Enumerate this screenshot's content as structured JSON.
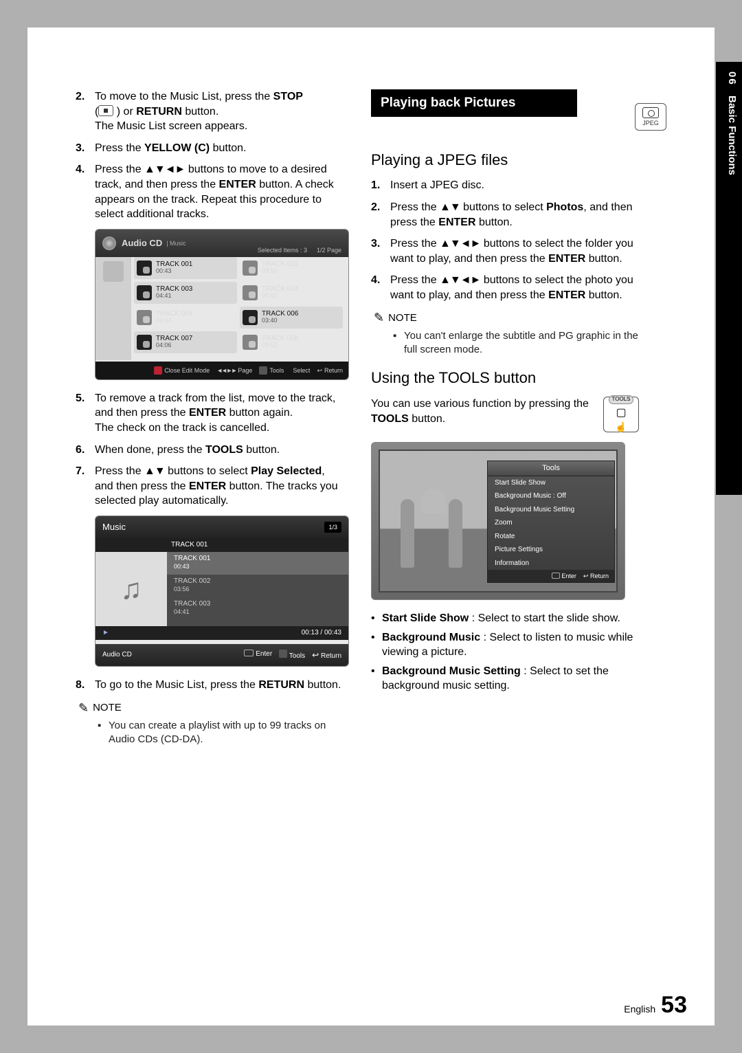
{
  "side": {
    "chapter_num": "06",
    "chapter_label": "Basic Functions"
  },
  "footer": {
    "lang": "English",
    "page": "53"
  },
  "jpeg_badge": "JPEG",
  "left": {
    "s2": {
      "num": "2.",
      "text_a": "To move to the Music List, press the ",
      "stop": "STOP",
      "text_b": " (",
      "text_c": " ) or ",
      "return": "RETURN",
      "text_d": " button.",
      "line2": "The Music List screen appears."
    },
    "s3": {
      "num": "3.",
      "text_a": "Press the ",
      "yellow": "YELLOW (C)",
      "text_b": " button."
    },
    "s4": {
      "num": "4.",
      "text_a": "Press the ",
      "arrows": "▲▼◄►",
      "text_b": " buttons to move to a desired track, and then press the ",
      "enter": "ENTER",
      "text_c": " button. A check appears on the track. Repeat this procedure to select additional tracks."
    },
    "s5": {
      "num": "5.",
      "text_a": "To remove a track from the list, move to the track, and then press the ",
      "enter": "ENTER",
      "text_b": " button again.",
      "line2": "The check on the track is cancelled."
    },
    "s6": {
      "num": "6.",
      "text_a": "When done, press the ",
      "tools": "TOOLS",
      "text_b": " button."
    },
    "s7": {
      "num": "7.",
      "text_a": "Press the ",
      "arrows": "▲▼",
      "text_b": " buttons to select ",
      "play": "Play Selected",
      "text_c": ", and then press the ",
      "enter": "ENTER",
      "text_d": " button. The tracks you selected play automatically."
    },
    "s8": {
      "num": "8.",
      "text_a": "To go to the Music List, press the ",
      "return": "RETURN",
      "text_b": " button."
    },
    "note_label": "NOTE",
    "note1": "You can create a playlist with up to 99 tracks on Audio CDs (CD-DA)."
  },
  "ui1": {
    "title": "Audio CD",
    "subtitle": "| Music",
    "selected": "Selected Items : 3",
    "page": "1/2 Page",
    "tracks": [
      {
        "name": "TRACK 001",
        "time": "00:43",
        "sel": true
      },
      {
        "name": "TRACK 002",
        "time": "03:56",
        "sel": false,
        "dim": true
      },
      {
        "name": "TRACK 003",
        "time": "04:41",
        "sel": true
      },
      {
        "name": "TRACK 004",
        "time": "04:02",
        "sel": false,
        "dim": true
      },
      {
        "name": "TRACK 005",
        "time": "03:43",
        "sel": false,
        "dim": true
      },
      {
        "name": "TRACK 006",
        "time": "03:40",
        "sel": true
      },
      {
        "name": "TRACK 007",
        "time": "04:06",
        "sel": true
      },
      {
        "name": "TRACK 008",
        "time": "03:52",
        "sel": false,
        "dim": true
      }
    ],
    "close": "Close Edit Mode",
    "pagebtn": "Page",
    "tools": "Tools",
    "select": "Select",
    "return": "Return"
  },
  "ui2": {
    "title": "Music",
    "page": "1/3",
    "now": "TRACK 001",
    "rows": [
      {
        "name": "TRACK 001",
        "time": "00:43"
      },
      {
        "name": "TRACK 002",
        "time": "03:56"
      },
      {
        "name": "TRACK 003",
        "time": "04:41"
      }
    ],
    "elapsed": "00:13 / 00:43",
    "source": "Audio CD",
    "enter": "Enter",
    "tools": "Tools",
    "return": "Return"
  },
  "right": {
    "banner": "Playing back Pictures",
    "h1": "Playing a JPEG files",
    "r1": {
      "num": "1.",
      "text": "Insert a JPEG disc."
    },
    "r2": {
      "num": "2.",
      "a": "Press the ",
      "arrows": "▲▼",
      "b": " buttons to select ",
      "photos": "Photos",
      "c": ", and then press the ",
      "enter": "ENTER",
      "d": " button."
    },
    "r3": {
      "num": "3.",
      "a": "Press the ",
      "arrows": "▲▼◄►",
      "b": " buttons to select the folder you want to play, and then press the ",
      "enter": "ENTER",
      "c": " button."
    },
    "r4": {
      "num": "4.",
      "a": "Press the ",
      "arrows": "▲▼◄►",
      "b": " buttons to select the photo you want to play, and then press the ",
      "enter": "ENTER",
      "c": " button."
    },
    "note_label": "NOTE",
    "note": "You can't enlarge the subtitle and PG graphic in the full screen mode.",
    "h2": "Using the TOOLS button",
    "intro_a": "You can use various function by pressing the ",
    "intro_tools": "TOOLS",
    "intro_b": " button.",
    "toolsbtn": "TOOLS",
    "bullets": [
      {
        "head": "Start Slide Show",
        "tail": " : Select to start the slide show."
      },
      {
        "head": "Background Music",
        "tail": " : Select to listen to music while viewing a picture."
      },
      {
        "head": "Background Music Setting",
        "tail": " : Select to set the background music setting."
      }
    ]
  },
  "ui3": {
    "title": "Tools",
    "items": [
      "Start Slide Show",
      "Background Music    :           Off",
      "Background Music Setting",
      "Zoom",
      "Rotate",
      "Picture Settings",
      "Information"
    ],
    "bgm_value": "Off",
    "enter": "Enter",
    "return": "Return"
  }
}
